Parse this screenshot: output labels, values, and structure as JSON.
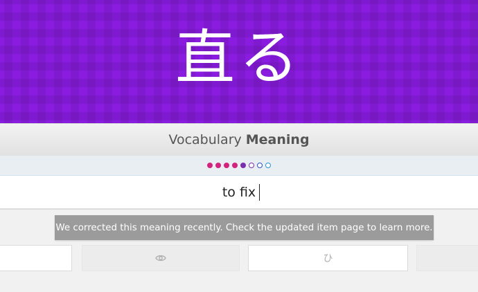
{
  "item": {
    "characters": "直る"
  },
  "prompt": {
    "type": "Vocabulary",
    "category": "Meaning"
  },
  "progress": {
    "dots": [
      {
        "state": "done",
        "color": "#d4237d"
      },
      {
        "state": "done",
        "color": "#d4237d"
      },
      {
        "state": "done",
        "color": "#d4237d"
      },
      {
        "state": "done",
        "color": "#d4237d"
      },
      {
        "state": "done",
        "color": "#7b2fb0"
      },
      {
        "state": "pending",
        "color": "#7b2fb0"
      },
      {
        "state": "pending",
        "color": "#2b4ed0"
      },
      {
        "state": "pending",
        "color": "#1f95e0"
      }
    ]
  },
  "answer": {
    "value": "to fix"
  },
  "tooltip": {
    "text": "We corrected this meaning recently. Check the updated item page to learn more."
  },
  "buttons": {
    "item_info_icon": "eye-icon",
    "kana_toggle_label": "ひ"
  },
  "colors": {
    "hero_background": "#8a1ce0"
  }
}
